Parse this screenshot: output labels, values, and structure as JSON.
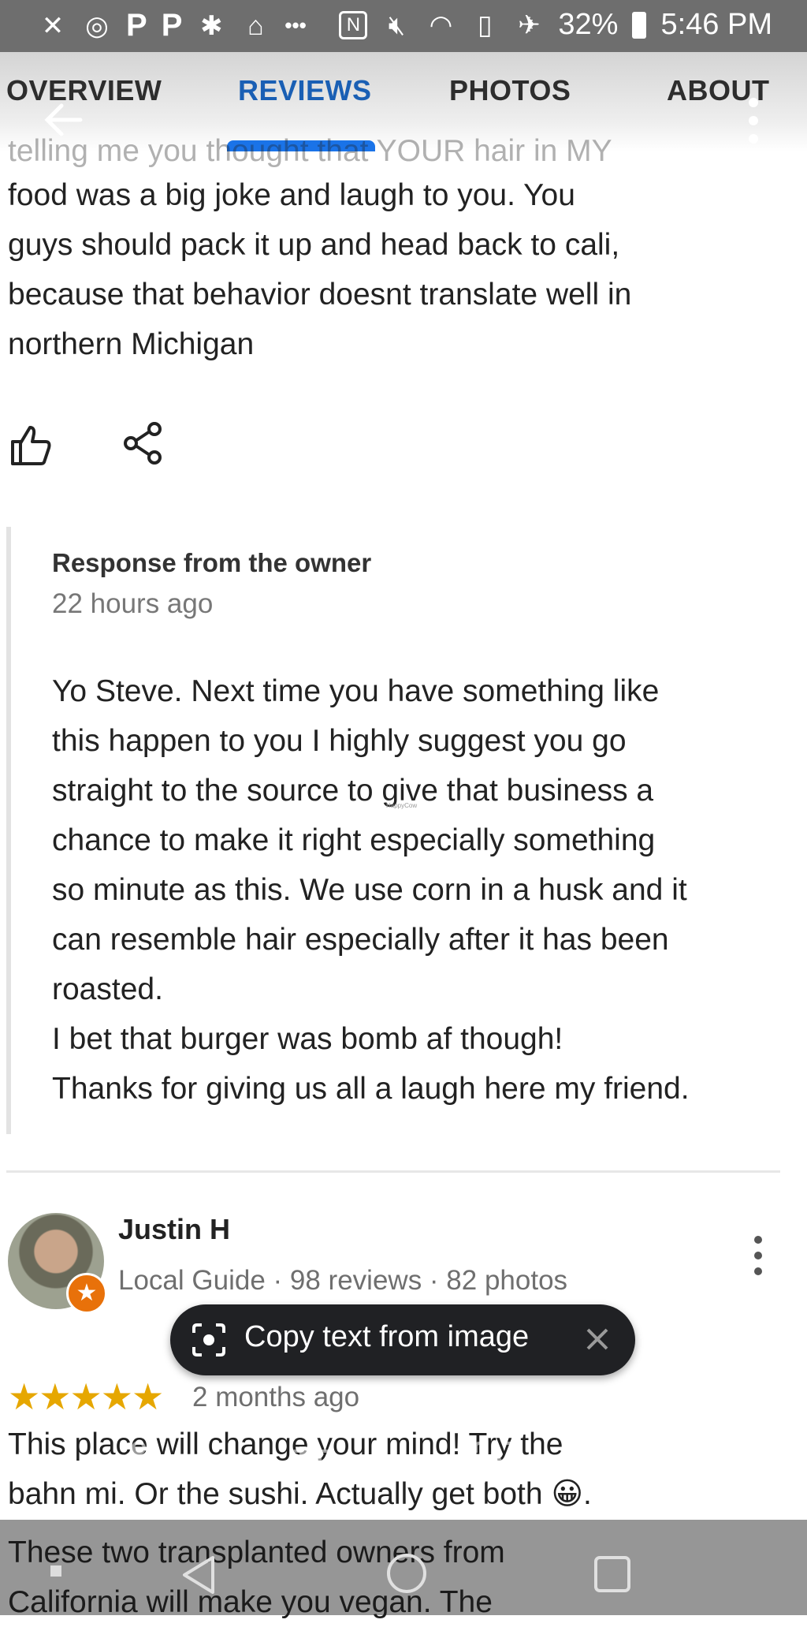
{
  "status_bar": {
    "left_icons": [
      "settings-x-icon",
      "p-icon",
      "p-icon",
      "dog-icon",
      "home-icon",
      "more-dots-icon"
    ],
    "p1": "P",
    "p2": "P",
    "dots": "•••",
    "battery": "32%",
    "time": "5:46 PM"
  },
  "tabs": [
    "OVERVIEW",
    "REVIEWS",
    "PHOTOS",
    "ABOUT"
  ],
  "active_tab": "REVIEWS",
  "review_top": {
    "cut_line": "telling me you thought that YOUR hair in MY",
    "lines": [
      "food was a big joke and laugh to you. You",
      "guys should pack it up and head back to cali,",
      "because that behavior doesnt translate well in",
      "northern Michigan"
    ]
  },
  "owner_response": {
    "title": "Response from the owner",
    "time": "22 hours ago",
    "lines": [
      "Yo Steve. Next time you have something like",
      "this happen to you I highly suggest you go",
      "straight to the source to give that business a",
      "chance to make it right especially something",
      "so minute as this. We use corn in a husk and it",
      "can resemble hair especially after it has been",
      "roasted.",
      "I bet that burger was bomb af though!",
      "Thanks for giving us all a laugh here my friend."
    ],
    "watermark": "HappyCow"
  },
  "next_review": {
    "reviewer": "Justin H",
    "meta": "Local Guide · 98 reviews · 82 photos",
    "stars": "★★★★★",
    "rating": 5,
    "age": "2 months ago",
    "lines": [
      "This place will change your mind!  Try the",
      "bahn mi.  Or the sushi.  Actually get both 😀.",
      "These two transplanted owners from",
      "California will make you vegan.  The"
    ]
  },
  "copy_pill": {
    "label": "Copy text from image"
  },
  "colors": {
    "accent": "#1a73e8",
    "star": "#e6a700",
    "badge": "#e8710a"
  }
}
